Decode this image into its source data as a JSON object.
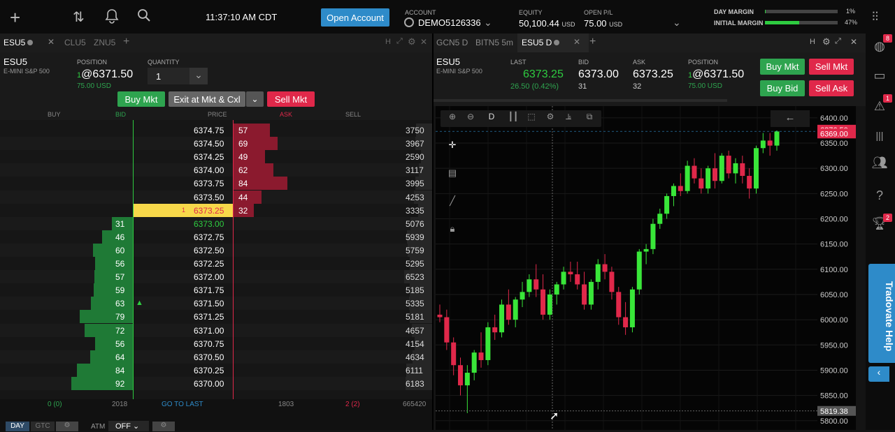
{
  "topbar": {
    "clock": "11:37:10 AM CDT",
    "open_account": "Open Account",
    "account_label": "ACCOUNT",
    "account_value": "DEMO5126336",
    "equity_label": "EQUITY",
    "equity_value": "50,100.44",
    "equity_unit": "USD",
    "openpl_label": "OPEN P/L",
    "openpl_value": "75.00",
    "openpl_unit": "USD",
    "day_margin_label": "DAY MARGIN",
    "day_margin_pct": "1%",
    "day_margin_fill": 0.01,
    "initial_margin_label": "INITIAL MARGIN",
    "initial_margin_pct": "47%",
    "initial_margin_fill": 0.47
  },
  "left_tabs": [
    "ESU5",
    "CLU5",
    "ZNU5"
  ],
  "right_tabs": [
    "GCN5 D",
    "BITN5 5m",
    "ESU5 D"
  ],
  "dom": {
    "symbol": "ESU5",
    "desc": "E-MINI S&P 500",
    "position_label": "POSITION",
    "position_qty": "1",
    "position_price": "@6371.50",
    "position_pl": "75.00 USD",
    "quantity_label": "QUANTITY",
    "quantity": "1",
    "buy_mkt": "Buy Mkt",
    "exit": "Exit at Mkt & Cxl",
    "sell_mkt": "Sell Mkt",
    "headers": {
      "buy": "BUY",
      "bid": "BID",
      "price": "PRICE",
      "ask": "ASK",
      "sell": "SELL"
    },
    "rows": [
      {
        "price": "6374.75",
        "ask": "57",
        "sell": "3750"
      },
      {
        "price": "6374.50",
        "ask": "69",
        "sell": "3967"
      },
      {
        "price": "6374.25",
        "ask": "49",
        "sell": "2590"
      },
      {
        "price": "6374.00",
        "ask": "62",
        "sell": "3117"
      },
      {
        "price": "6373.75",
        "ask": "84",
        "sell": "3995"
      },
      {
        "price": "6373.50",
        "ask": "44",
        "sell": "4253"
      },
      {
        "price": "6373.25",
        "ask": "32",
        "sell": "3335",
        "last": "1"
      },
      {
        "price": "6373.00",
        "bid": "31",
        "sell": "5076"
      },
      {
        "price": "6372.75",
        "bid": "46",
        "sell": "5939"
      },
      {
        "price": "6372.50",
        "bid": "60",
        "sell": "5759"
      },
      {
        "price": "6372.25",
        "bid": "56",
        "sell": "5295"
      },
      {
        "price": "6372.00",
        "bid": "57",
        "sell": "6523"
      },
      {
        "price": "6371.75",
        "bid": "59",
        "sell": "5185"
      },
      {
        "price": "6371.50",
        "bid": "63",
        "sell": "5335"
      },
      {
        "price": "6371.25",
        "bid": "79",
        "sell": "5181"
      },
      {
        "price": "6371.00",
        "bid": "72",
        "sell": "4657"
      },
      {
        "price": "6370.75",
        "bid": "56",
        "sell": "4154"
      },
      {
        "price": "6370.50",
        "bid": "64",
        "sell": "4634"
      },
      {
        "price": "6370.25",
        "bid": "84",
        "sell": "6111"
      },
      {
        "price": "6370.00",
        "bid": "92",
        "sell": "6183"
      }
    ],
    "footer": {
      "buy_total": "0 (0)",
      "bid_total": "2018",
      "go_to_last": "GO TO LAST",
      "ask_total": "1803",
      "sell_total": "2 (2)",
      "sell_vol": "665420",
      "day": "DAY",
      "gtc": "GTC",
      "atm": "ATM",
      "off": "OFF"
    }
  },
  "quote": {
    "symbol": "ESU5",
    "desc": "E-MINI S&P 500",
    "last_label": "LAST",
    "last": "6373.25",
    "change": "26.50 (0.42%)",
    "bid_label": "BID",
    "bid": "6373.00",
    "bid_size": "31",
    "ask_label": "ASK",
    "ask": "6373.25",
    "ask_size": "32",
    "position_label": "POSITION",
    "position_qty": "1",
    "position_price": "@6371.50",
    "position_pl": "75.00 USD",
    "buy_mkt": "Buy Mkt",
    "sell_mkt": "Sell Mkt",
    "buy_bid": "Buy Bid",
    "sell_ask": "Sell Ask",
    "interval": "D"
  },
  "chart_data": {
    "type": "candlestick",
    "symbol": "ESU5",
    "interval": "D",
    "y_ticks": [
      "6400.00",
      "6350.00",
      "6300.00",
      "6250.00",
      "6200.00",
      "6150.00",
      "6100.00",
      "6050.00",
      "6000.00",
      "5950.00",
      "5900.00",
      "5850.00",
      "5800.00"
    ],
    "ylim": [
      5790,
      6415
    ],
    "price_labels": [
      {
        "text": "6376.50",
        "value": 6376.5,
        "color": "#e0284a"
      },
      {
        "text": "6369.00",
        "value": 6369,
        "color": "#e0284a"
      },
      {
        "text": "5819.38",
        "value": 5819.38,
        "color": "#555"
      }
    ],
    "candles": [
      [
        6010,
        6030,
        5995,
        6005
      ],
      [
        6005,
        6020,
        5940,
        5955
      ],
      [
        5955,
        5965,
        5890,
        5910
      ],
      [
        5910,
        5925,
        5850,
        5870
      ],
      [
        5870,
        5910,
        5815,
        5895
      ],
      [
        5895,
        5940,
        5880,
        5935
      ],
      [
        5935,
        5975,
        5905,
        5920
      ],
      [
        5920,
        5995,
        5910,
        5985
      ],
      [
        5985,
        6010,
        5960,
        5975
      ],
      [
        5975,
        6040,
        5965,
        6030
      ],
      [
        6030,
        6060,
        5990,
        6000
      ],
      [
        6000,
        6045,
        5985,
        6040
      ],
      [
        6040,
        6075,
        6025,
        6055
      ],
      [
        6055,
        6090,
        6045,
        6080
      ],
      [
        6080,
        6110,
        6045,
        6060
      ],
      [
        6060,
        6090,
        6000,
        6010
      ],
      [
        6010,
        6060,
        6000,
        6050
      ],
      [
        6050,
        6075,
        6030,
        6070
      ],
      [
        6070,
        6105,
        6060,
        6095
      ],
      [
        6095,
        6115,
        6075,
        6090
      ],
      [
        6090,
        6115,
        6060,
        6070
      ],
      [
        6070,
        6095,
        6020,
        6030
      ],
      [
        6030,
        6080,
        6020,
        6075
      ],
      [
        6075,
        6120,
        6060,
        6110
      ],
      [
        6110,
        6130,
        6080,
        6095
      ],
      [
        6095,
        6105,
        6040,
        6055
      ],
      [
        6055,
        6065,
        5990,
        6005
      ],
      [
        6005,
        6035,
        5970,
        5985
      ],
      [
        5985,
        6065,
        5975,
        6060
      ],
      [
        6060,
        6140,
        6050,
        6135
      ],
      [
        6135,
        6150,
        6110,
        6140
      ],
      [
        6140,
        6200,
        6130,
        6190
      ],
      [
        6190,
        6220,
        6180,
        6210
      ],
      [
        6210,
        6250,
        6200,
        6245
      ],
      [
        6245,
        6270,
        6225,
        6265
      ],
      [
        6265,
        6290,
        6245,
        6255
      ],
      [
        6255,
        6315,
        6250,
        6305
      ],
      [
        6305,
        6320,
        6270,
        6280
      ],
      [
        6280,
        6300,
        6250,
        6260
      ],
      [
        6260,
        6305,
        6250,
        6300
      ],
      [
        6300,
        6330,
        6260,
        6275
      ],
      [
        6275,
        6330,
        6270,
        6325
      ],
      [
        6325,
        6335,
        6280,
        6290
      ],
      [
        6290,
        6320,
        6270,
        6310
      ],
      [
        6310,
        6325,
        6270,
        6285
      ],
      [
        6285,
        6300,
        6240,
        6260
      ],
      [
        6260,
        6345,
        6250,
        6340
      ],
      [
        6340,
        6370,
        6330,
        6355
      ],
      [
        6355,
        6370,
        6325,
        6345
      ],
      [
        6345,
        6375,
        6335,
        6373
      ]
    ]
  },
  "sidebar": {
    "badge_top": "8",
    "badge_alert": "1",
    "badge_trophy": "2",
    "help": "Tradovate Help"
  }
}
